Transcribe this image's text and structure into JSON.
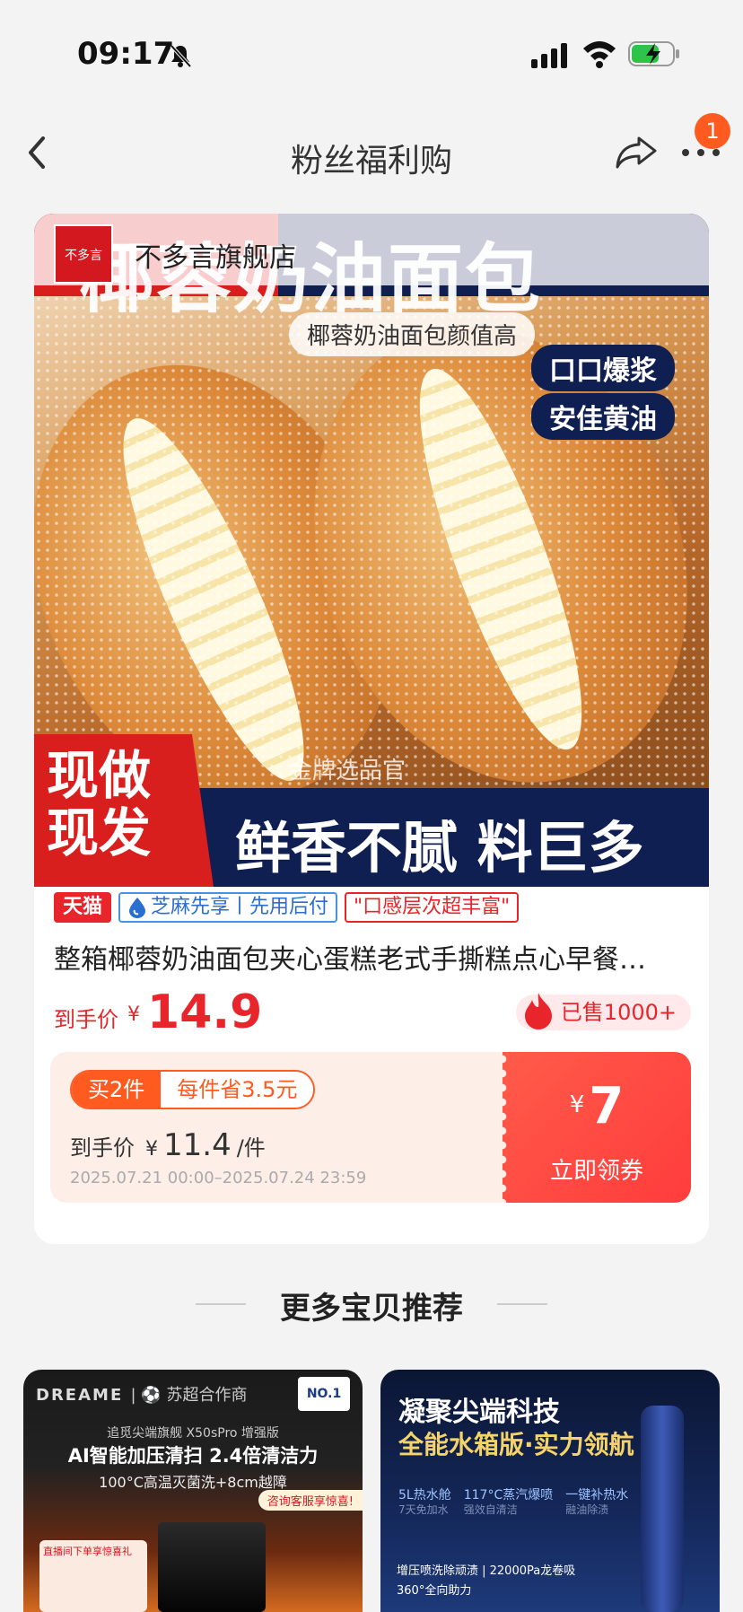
{
  "status_bar": {
    "time": "09:17"
  },
  "nav": {
    "title": "粉丝福利购",
    "badge_count": "1"
  },
  "product": {
    "store_logo_text": "不多言",
    "store_name": "不多言旗舰店",
    "hero": {
      "banner_big": "椰蓉奶油面包",
      "subtitle": "椰蓉奶油面包颜值高",
      "pill1": "口口爆浆",
      "pill2": "安佳黄油",
      "watermark": "金牌选品官",
      "bottom_red": "现做现发",
      "bottom_text": "鲜香不腻 料巨多"
    },
    "tags": {
      "tmall": "天猫",
      "zhima": "芝麻先享丨先用后付",
      "quote": "\"口感层次超丰富\""
    },
    "title": "整箱椰蓉奶油面包夹心蛋糕老式手撕糕点心早餐…",
    "price_label": "到手价",
    "price_currency": "¥",
    "price_value": "14.9",
    "sold": "已售1000+",
    "coupon": {
      "buy_qty": "买2件",
      "save": "每件省3.5元",
      "price_label": "到手价",
      "price_currency": "¥",
      "price_value": "11.4",
      "price_unit": "/件",
      "date_range": "2025.07.21 00:00–2025.07.24 23:59",
      "amount_currency": "¥",
      "amount": "7",
      "action": "立即领券"
    }
  },
  "more": {
    "title": "更多宝贝推荐"
  },
  "recommend": [
    {
      "brand": "DREAME",
      "brand_sub": "| ⚽ 苏超合作商",
      "badge": "NO.1",
      "small": "追觅尖端旗舰 X50sPro 增强版",
      "headline": "AI智能加压清扫 2.4倍清洁力",
      "line3": "100°C高温灭菌洗+8cm越障",
      "service": "咨询客服享惊喜!",
      "box_text": "直播间下单享惊喜礼"
    },
    {
      "title1": "凝聚尖端科技",
      "title2": "全能水箱版·实力领航",
      "features": [
        {
          "main": "5L热水舱",
          "sub": "7天免加水"
        },
        {
          "main": "117°C蒸汽爆喷",
          "sub": "强效自清洁"
        },
        {
          "main": "一键补热水",
          "sub": "融油除渍"
        }
      ],
      "bottom1": "增压喷洗除顽渍 | 22000Pa龙卷吸",
      "bottom2": "360°全向助力"
    }
  ]
}
